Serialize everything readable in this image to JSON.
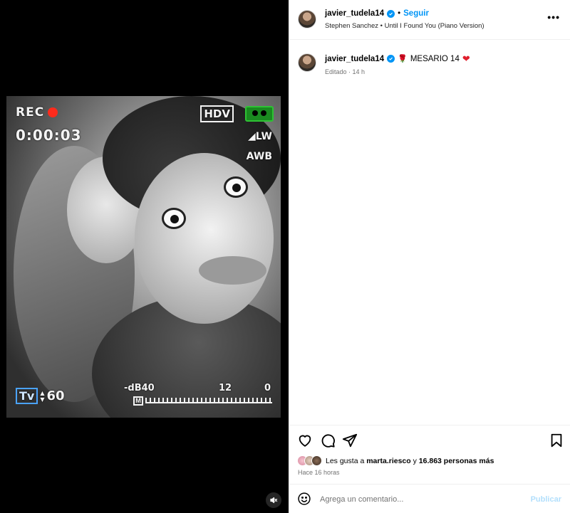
{
  "media": {
    "hud": {
      "rec": "REC",
      "timecode": "0:00:03",
      "format": "HDV",
      "lw": "LW",
      "awb": "AWB",
      "tv": "Tv",
      "tv_value": "60",
      "db_label": "-dB40",
      "meter_mid": "12",
      "meter_end": "0",
      "meter_m": "M"
    },
    "mute_icon": "speaker-muted-icon"
  },
  "post": {
    "header": {
      "username": "javier_tudela14",
      "separator": "•",
      "follow_label": "Seguir",
      "song": "Stephen Sanchez • Until I Found You (Piano Version)",
      "more_label": "•••"
    },
    "caption": {
      "username": "javier_tudela14",
      "text": "MESARIO 14",
      "emoji_before": "🌹",
      "emoji_after": "❤",
      "meta": "Editado · 14 h"
    },
    "actions": {
      "icons": [
        "heart-icon",
        "comment-icon",
        "share-icon",
        "bookmark-icon"
      ]
    },
    "likes": {
      "prefix": "Les gusta a",
      "user": "marta.riesco",
      "connector": "y",
      "count": "16.863 personas más"
    },
    "time_ago": "Hace 16 horas",
    "comment": {
      "placeholder": "Agrega un comentario...",
      "publish_label": "Publicar"
    }
  },
  "colors": {
    "accent": "#0095f6",
    "rec_red": "#ff2b1c",
    "battery_green": "#2ec234",
    "publish_disabled": "#b2dffc",
    "heart_red": "#e0202e"
  }
}
